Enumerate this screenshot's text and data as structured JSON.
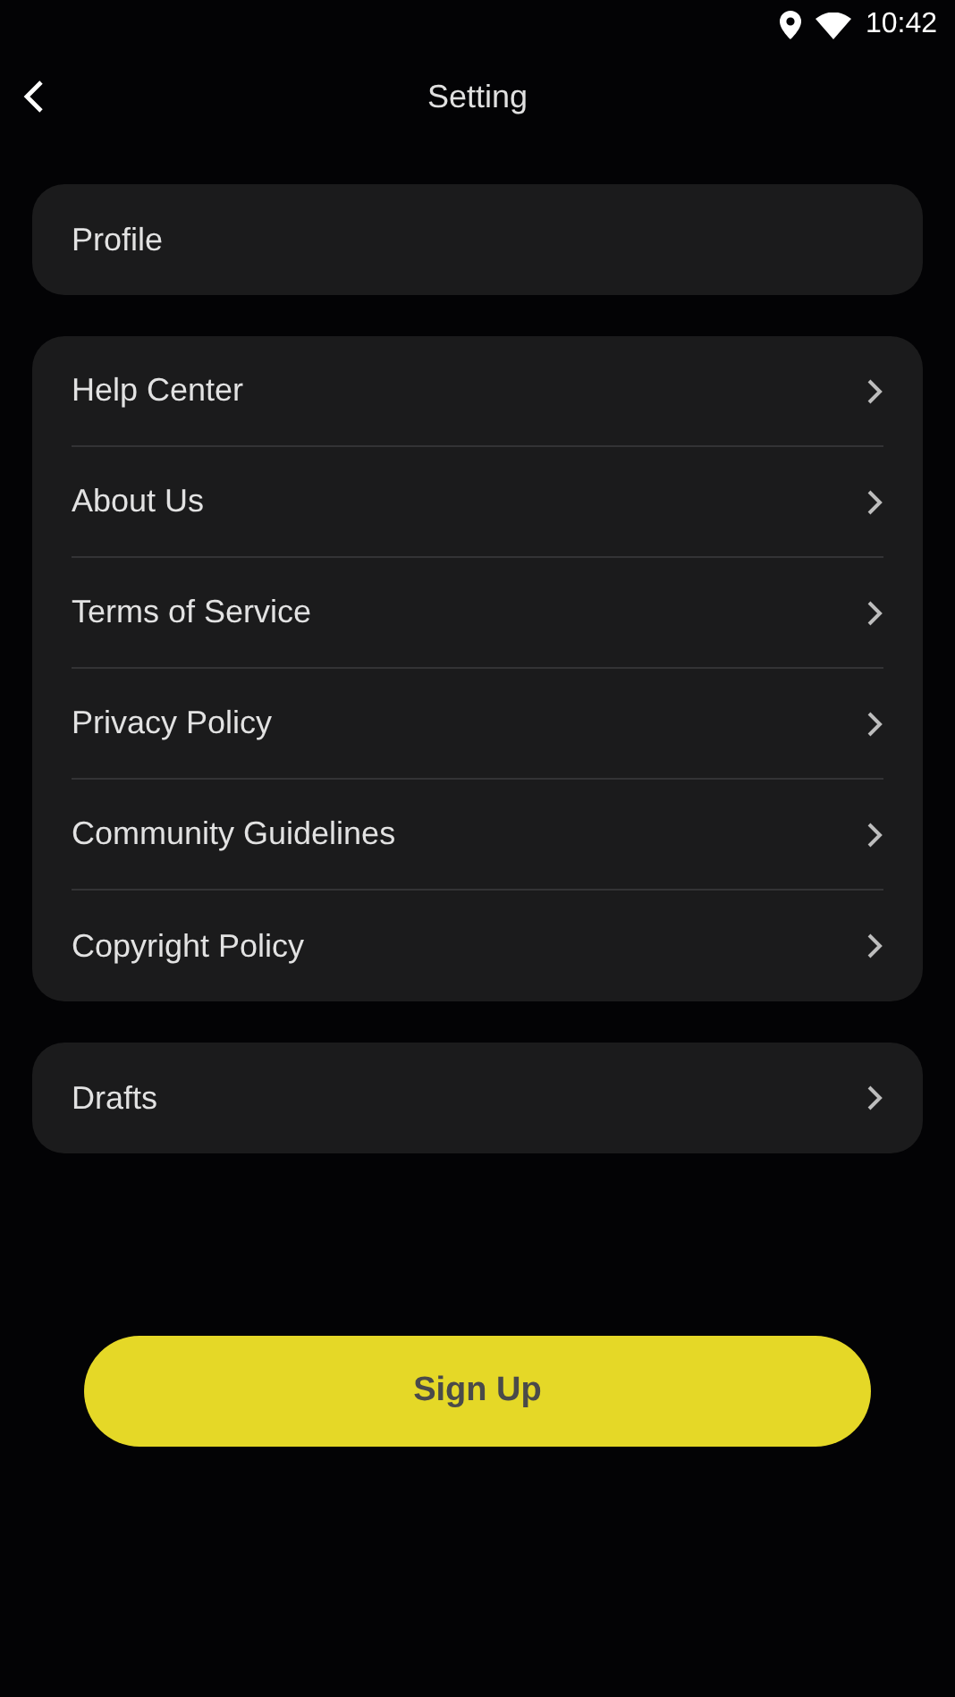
{
  "status_bar": {
    "time": "10:42"
  },
  "header": {
    "title": "Setting"
  },
  "groups": [
    {
      "items": [
        {
          "label": "Profile",
          "kind": "plain"
        }
      ]
    },
    {
      "items": [
        {
          "label": "Help Center",
          "kind": "link"
        },
        {
          "label": "About Us",
          "kind": "link"
        },
        {
          "label": "Terms of Service",
          "kind": "link"
        },
        {
          "label": "Privacy Policy",
          "kind": "link"
        },
        {
          "label": "Community Guidelines",
          "kind": "link"
        },
        {
          "label": "Copyright Policy",
          "kind": "link"
        }
      ]
    },
    {
      "items": [
        {
          "label": "Drafts",
          "kind": "link"
        }
      ]
    }
  ],
  "button": {
    "label": "Sign Up"
  }
}
